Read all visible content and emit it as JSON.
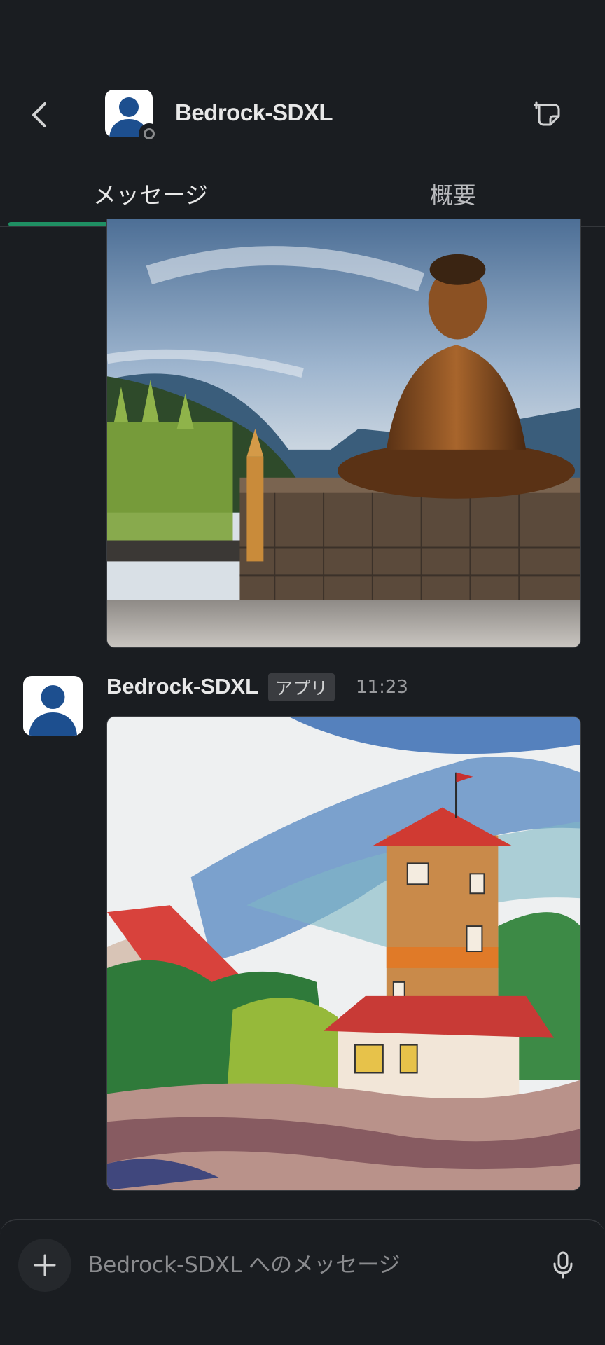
{
  "header": {
    "title": "Bedrock-SDXL",
    "back_icon": "chevron-left-icon",
    "compose_icon": "new-message-icon"
  },
  "tabs": [
    {
      "label": "メッセージ",
      "active": true
    },
    {
      "label": "概要",
      "active": false
    }
  ],
  "messages": [
    {
      "image_subject": "buddha-statue-mountains",
      "sender": null
    },
    {
      "sender": "Bedrock-SDXL",
      "badge": "アプリ",
      "time": "11:23",
      "image_subject": "watercolor-tower-village"
    }
  ],
  "composer": {
    "placeholder": "Bedrock-SDXL へのメッセージ",
    "plus_icon": "plus-icon",
    "mic_icon": "microphone-icon"
  },
  "colors": {
    "background": "#1a1d21",
    "accent_tab": "#1f8f63",
    "avatar_blue": "#1d4f8f"
  }
}
